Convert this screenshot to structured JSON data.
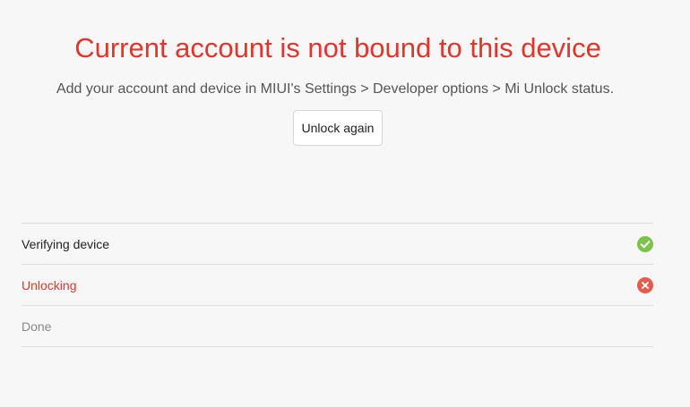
{
  "header": {
    "title": "Current account is not bound to this device",
    "message": "Add your account and device in MIUI's Settings > Developer options > Mi Unlock status."
  },
  "actions": {
    "unlock_again_label": "Unlock again"
  },
  "steps": [
    {
      "label": "Verifying device",
      "status": "success",
      "icon": "check-circle-icon",
      "color": "#7bc34a"
    },
    {
      "label": "Unlocking",
      "status": "failed",
      "icon": "cross-circle-icon",
      "color": "#e85a49"
    },
    {
      "label": "Done",
      "status": "pending",
      "icon": "",
      "color": ""
    }
  ],
  "colors": {
    "error": "#e0362c",
    "success": "#7bc34a",
    "background": "#f7f7f7"
  }
}
